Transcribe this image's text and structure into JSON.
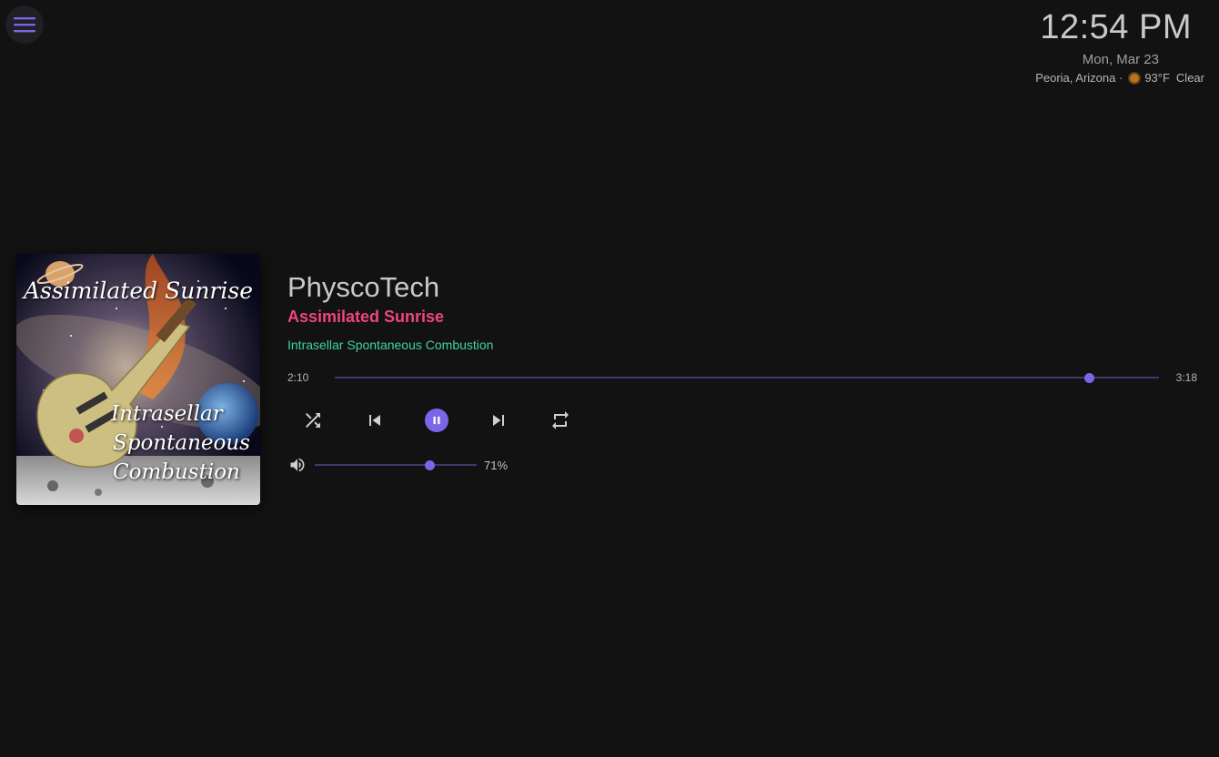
{
  "header": {
    "menu_icon": "hamburger-menu-icon",
    "time": "12:54 PM",
    "date": "Mon, Mar 23",
    "location": "Peoria, Arizona ·",
    "weather_icon": "sun-icon",
    "temperature": "93°F",
    "condition": "Clear"
  },
  "album_art": {
    "title_text": "Assimilated Sunrise",
    "subtitle_lines": [
      "Intrasellar",
      "Spontaneous",
      "Combustion"
    ]
  },
  "now_playing": {
    "artist": "PhyscoTech",
    "track": "Assimilated Sunrise",
    "album": "Intrasellar Spontaneous Combustion",
    "elapsed": "2:10",
    "duration": "3:18",
    "progress_fraction": 0.916
  },
  "controls": {
    "shuffle_icon": "shuffle-icon",
    "previous_icon": "skip-previous-icon",
    "pause_icon": "pause-icon",
    "next_icon": "skip-next-icon",
    "repeat_icon": "repeat-icon"
  },
  "volume": {
    "icon": "volume-up-icon",
    "level_percent": 71,
    "label": "71%"
  },
  "colors": {
    "accent": "#7a67e8",
    "track_title": "#f0457c",
    "album_text": "#3fd2a6",
    "background": "#121212"
  }
}
